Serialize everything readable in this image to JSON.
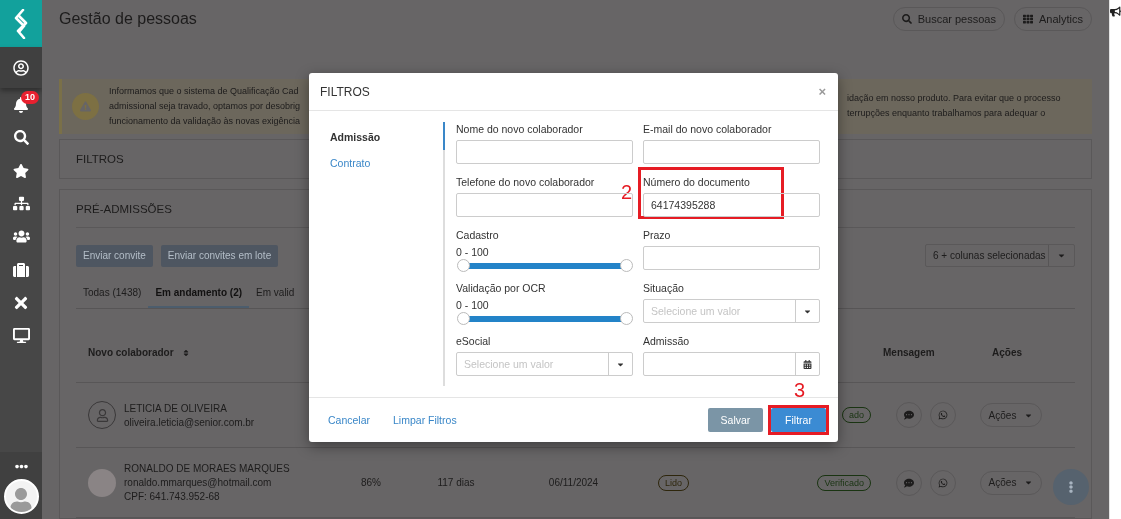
{
  "sidebar": {
    "notification_badge": "10"
  },
  "header": {
    "title": "Gestão de pessoas",
    "search_button": "Buscar pessoas",
    "analytics_button": "Analytics"
  },
  "alert": {
    "text_left": [
      "Informamos que o sistema de Qualificação Cad",
      "admissional seja travado, optamos por desobrig",
      "funcionamento da validação às novas exigência"
    ],
    "text_right": [
      "idação em nosso produto. Para evitar que o processo",
      "terrupções enquanto trabalhamos para adequar o"
    ]
  },
  "filters_card": {
    "title": "FILTROS"
  },
  "pre_admissions": {
    "title": "PRÉ-ADMISSÕES",
    "buttons": [
      "Enviar convite",
      "Enviar convites em lote"
    ],
    "columns_select": "6 + colunas selecionadas",
    "tabs": [
      {
        "label": "Todas (1438)",
        "selected": false
      },
      {
        "label": "Em andamento (2)",
        "selected": true
      },
      {
        "label": "Em valid",
        "selected": false
      }
    ],
    "columns": [
      "Novo colaborador",
      "Mensagem",
      "Ações"
    ],
    "rows": [
      {
        "kind": "placeholder",
        "name": "LETICIA DE OLIVEIRA",
        "email": "oliveira.leticia@senior.com.br",
        "status": "ado",
        "actions": "Ações"
      },
      {
        "kind": "photo",
        "name": "RONALDO DE MORAES MARQUES",
        "email": "ronaldo.mmarques@hotmail.com",
        "cpf": "CPF: 641.743.952-68",
        "progress": "86%",
        "deadline": "117 dias",
        "date": "06/11/2024",
        "read_status": "Lido",
        "status": "Verificado",
        "actions": "Ações"
      }
    ]
  },
  "modal": {
    "title": "FILTROS",
    "close": "×",
    "nav": [
      {
        "label": "Admissão",
        "selected": true
      },
      {
        "label": "Contrato",
        "selected": false
      }
    ],
    "fields": [
      {
        "kind": "text",
        "label": "Nome do novo colaborador"
      },
      {
        "kind": "text",
        "label": "E-mail do novo colaborador"
      },
      {
        "kind": "text",
        "label": "Telefone do novo colaborador"
      },
      {
        "kind": "text",
        "label": "Número do documento",
        "value": "64174395288",
        "callout": "2"
      },
      {
        "kind": "range",
        "label": "Cadastro",
        "reading": "0 - 100",
        "level": 1
      },
      {
        "kind": "text",
        "label": "Prazo"
      },
      {
        "kind": "range",
        "label": "Validação por OCR",
        "reading": "0 - 100",
        "level": 1
      },
      {
        "kind": "select",
        "label": "Situação",
        "placeholder": "Selecione um valor"
      },
      {
        "kind": "select",
        "label": "eSocial",
        "placeholder": "Selecione um valor"
      },
      {
        "kind": "date",
        "label": "Admissão"
      }
    ],
    "links": [
      "Cancelar",
      "Limpar Filtros"
    ],
    "buttons": [
      {
        "label": "Salvar",
        "kind": "secondary"
      },
      {
        "label": "Filtrar",
        "kind": "primary",
        "callout": "3"
      }
    ]
  }
}
